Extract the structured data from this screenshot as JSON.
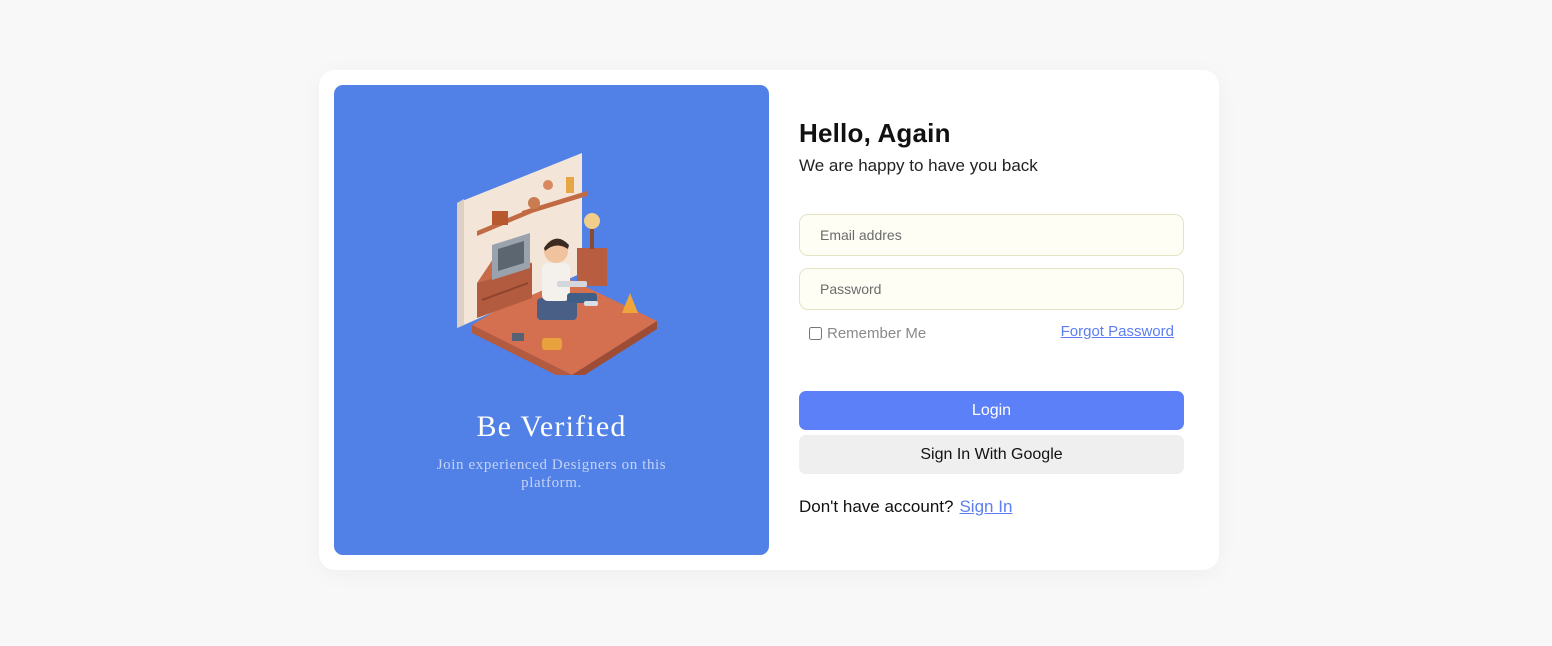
{
  "illustration": {
    "icon": "isometric-room-illustration"
  },
  "promo": {
    "title": "Be Verified",
    "subtitle": "Join experienced Designers on this platform."
  },
  "login": {
    "heading": "Hello, Again",
    "subheading": "We are happy to have you back",
    "email_placeholder": "Email addres",
    "password_placeholder": "Password",
    "remember_label": "Remember Me",
    "forgot_label": "Forgot Password",
    "login_button": "Login",
    "google_button": "Sign In With Google",
    "no_account_text": "Don't have account?",
    "signin_link": "Sign In"
  },
  "colors": {
    "panel_blue": "#5181e6",
    "button_blue": "#5b80f7",
    "link_blue": "#5c7ef1"
  }
}
